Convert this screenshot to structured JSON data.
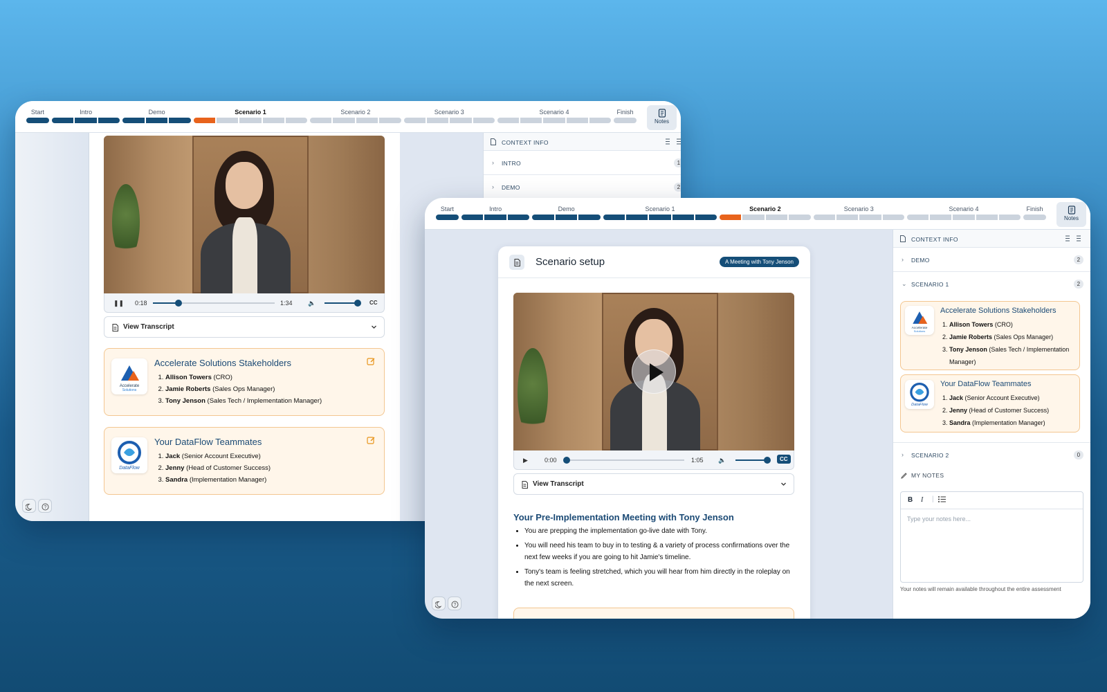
{
  "stages": [
    "Start",
    "Intro",
    "Demo",
    "Scenario 1",
    "Scenario 2",
    "Scenario 3",
    "Scenario 4",
    "Finish"
  ],
  "window1": {
    "current_stage": "Scenario 1",
    "notes_label": "Notes",
    "video": {
      "time": "0:18",
      "duration": "1:34",
      "cc": "CC",
      "progress": 0.21
    },
    "transcript_label": "View Transcript",
    "context": {
      "title": "CONTEXT INFO",
      "rows": [
        {
          "label": "INTRO",
          "count": "1"
        },
        {
          "label": "DEMO",
          "count": "2"
        }
      ]
    }
  },
  "window2": {
    "current_stage": "Scenario 2",
    "notes_label": "Notes",
    "setup_title": "Scenario setup",
    "badge": "A Meeting with Tony Jenson",
    "video": {
      "time": "0:00",
      "duration": "1:05",
      "cc": "CC",
      "progress": 0.0
    },
    "transcript_label": "View Transcript",
    "meeting_heading": "Your Pre-Implementation Meeting with Tony Jenson",
    "bullets": [
      "You are prepping the implementation go-live date with Tony.",
      "You will need his team to buy in to testing & a variety of process confirmations over the next few weeks if you are going to hit Jamie's timeline.",
      "Tony's team is feeling stretched, which you will hear from him directly in the roleplay on the next screen."
    ],
    "context": {
      "title": "CONTEXT INFO",
      "rows": [
        {
          "label": "DEMO",
          "count": "2"
        },
        {
          "label": "SCENARIO 1",
          "count": "2"
        },
        {
          "label": "SCENARIO 2",
          "count": "0"
        }
      ]
    },
    "notes": {
      "title": "MY NOTES",
      "placeholder": "Type your notes here...",
      "footer": "Your notes will remain available throughout the entire assessment",
      "bold": "B",
      "italic": "I"
    }
  },
  "stakeholders": {
    "title": "Accelerate Solutions Stakeholders",
    "logo_text": "Accelerate Solutions",
    "people": [
      {
        "name": "Allison Towers",
        "role": "(CRO)"
      },
      {
        "name": "Jamie Roberts",
        "role": "(Sales Ops Manager)"
      },
      {
        "name": "Tony Jenson",
        "role": "(Sales Tech / Implementation Manager)"
      }
    ]
  },
  "teammates": {
    "title": "Your DataFlow Teammates",
    "logo_text": "DataFlow",
    "people": [
      {
        "name": "Jack",
        "role": "(Senior Account Executive)"
      },
      {
        "name": "Jenny",
        "role": "(Head of Customer Success)"
      },
      {
        "name": "Sandra",
        "role": "(Implementation Manager)"
      }
    ]
  },
  "colors": {
    "primary": "#154e78",
    "active_stage": "#e8631c",
    "card_bg": "#fff6ea",
    "card_border": "#f3c690"
  }
}
